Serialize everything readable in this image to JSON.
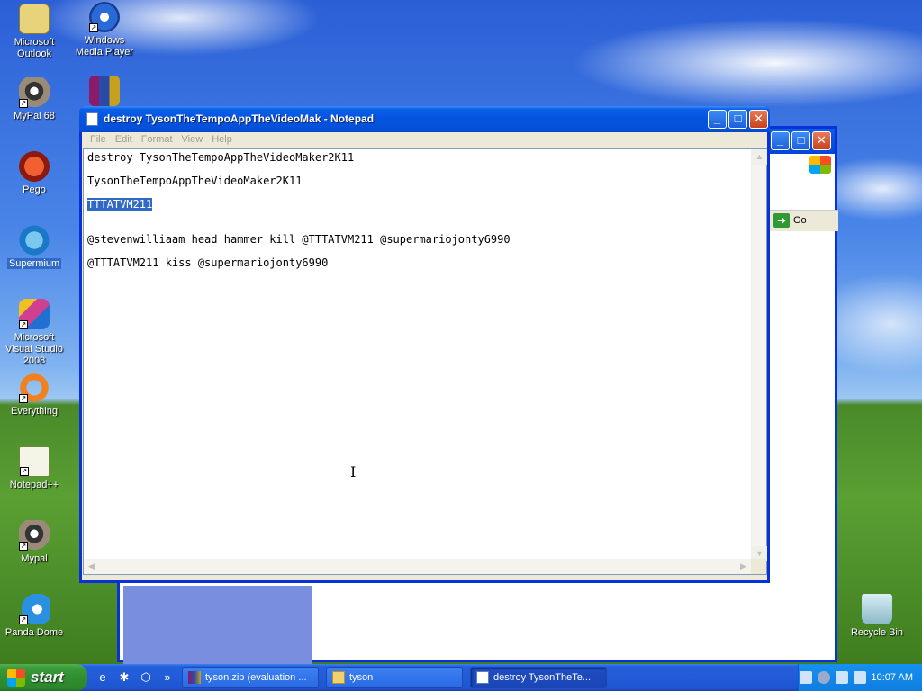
{
  "desktop": {
    "icons": [
      {
        "label": "Microsoft Outlook",
        "icon": "outlook-icon",
        "shortcut": false
      },
      {
        "label": "Windows Media Player",
        "icon": "media-player-icon",
        "shortcut": true
      },
      {
        "label": "MyPal 68",
        "icon": "raccoon-icon",
        "shortcut": true
      },
      {
        "label": "",
        "icon": "winrar-icon",
        "shortcut": false
      },
      {
        "label": "Pego",
        "icon": "pego-icon",
        "shortcut": false
      },
      {
        "label": "Supermium",
        "icon": "supermium-icon",
        "shortcut": false,
        "selected": true
      },
      {
        "label": "Microsoft Visual Studio 2008",
        "icon": "visual-studio-icon",
        "shortcut": true
      },
      {
        "label": "Everything",
        "icon": "everything-icon",
        "shortcut": true
      },
      {
        "label": "Notepad++",
        "icon": "notepadpp-icon",
        "shortcut": true
      },
      {
        "label": "Mypal",
        "icon": "raccoon-icon",
        "shortcut": true
      },
      {
        "label": "Panda Dome",
        "icon": "panda-dome-icon",
        "shortcut": true
      },
      {
        "label": "Recycle Bin",
        "icon": "recycle-bin-icon",
        "shortcut": false
      }
    ]
  },
  "bg_window": {
    "go_label": "Go"
  },
  "notepad": {
    "title": "destroy TysonTheTempoAppTheVideoMak - Notepad",
    "menu": [
      "File",
      "Edit",
      "Format",
      "View",
      "Help"
    ],
    "lines": [
      "destroy TysonTheTempoAppTheVideoMaker2K11",
      "TysonTheTempoAppTheVideoMaker2K11",
      "TTTATVM211",
      "@stevenwilliaam head hammer kill @TTTATVM211 @supermariojonty6990",
      "@TTTATVM211 kiss @supermariojonty6990"
    ],
    "selected_line_index": 2
  },
  "taskbar": {
    "start_label": "start",
    "tasks": [
      {
        "label": "tyson.zip (evaluation ...",
        "icon": "winrar-icon",
        "active": false
      },
      {
        "label": "tyson",
        "icon": "folder-icon",
        "active": false
      },
      {
        "label": "destroy TysonTheTe...",
        "icon": "notepad-icon",
        "active": true
      }
    ],
    "clock": "10:07 AM"
  },
  "colors": {
    "selection": "#316ac5",
    "title_bar": "#0553e0",
    "start_green": "#3c9a3c",
    "taskbar_blue": "#245edb"
  }
}
